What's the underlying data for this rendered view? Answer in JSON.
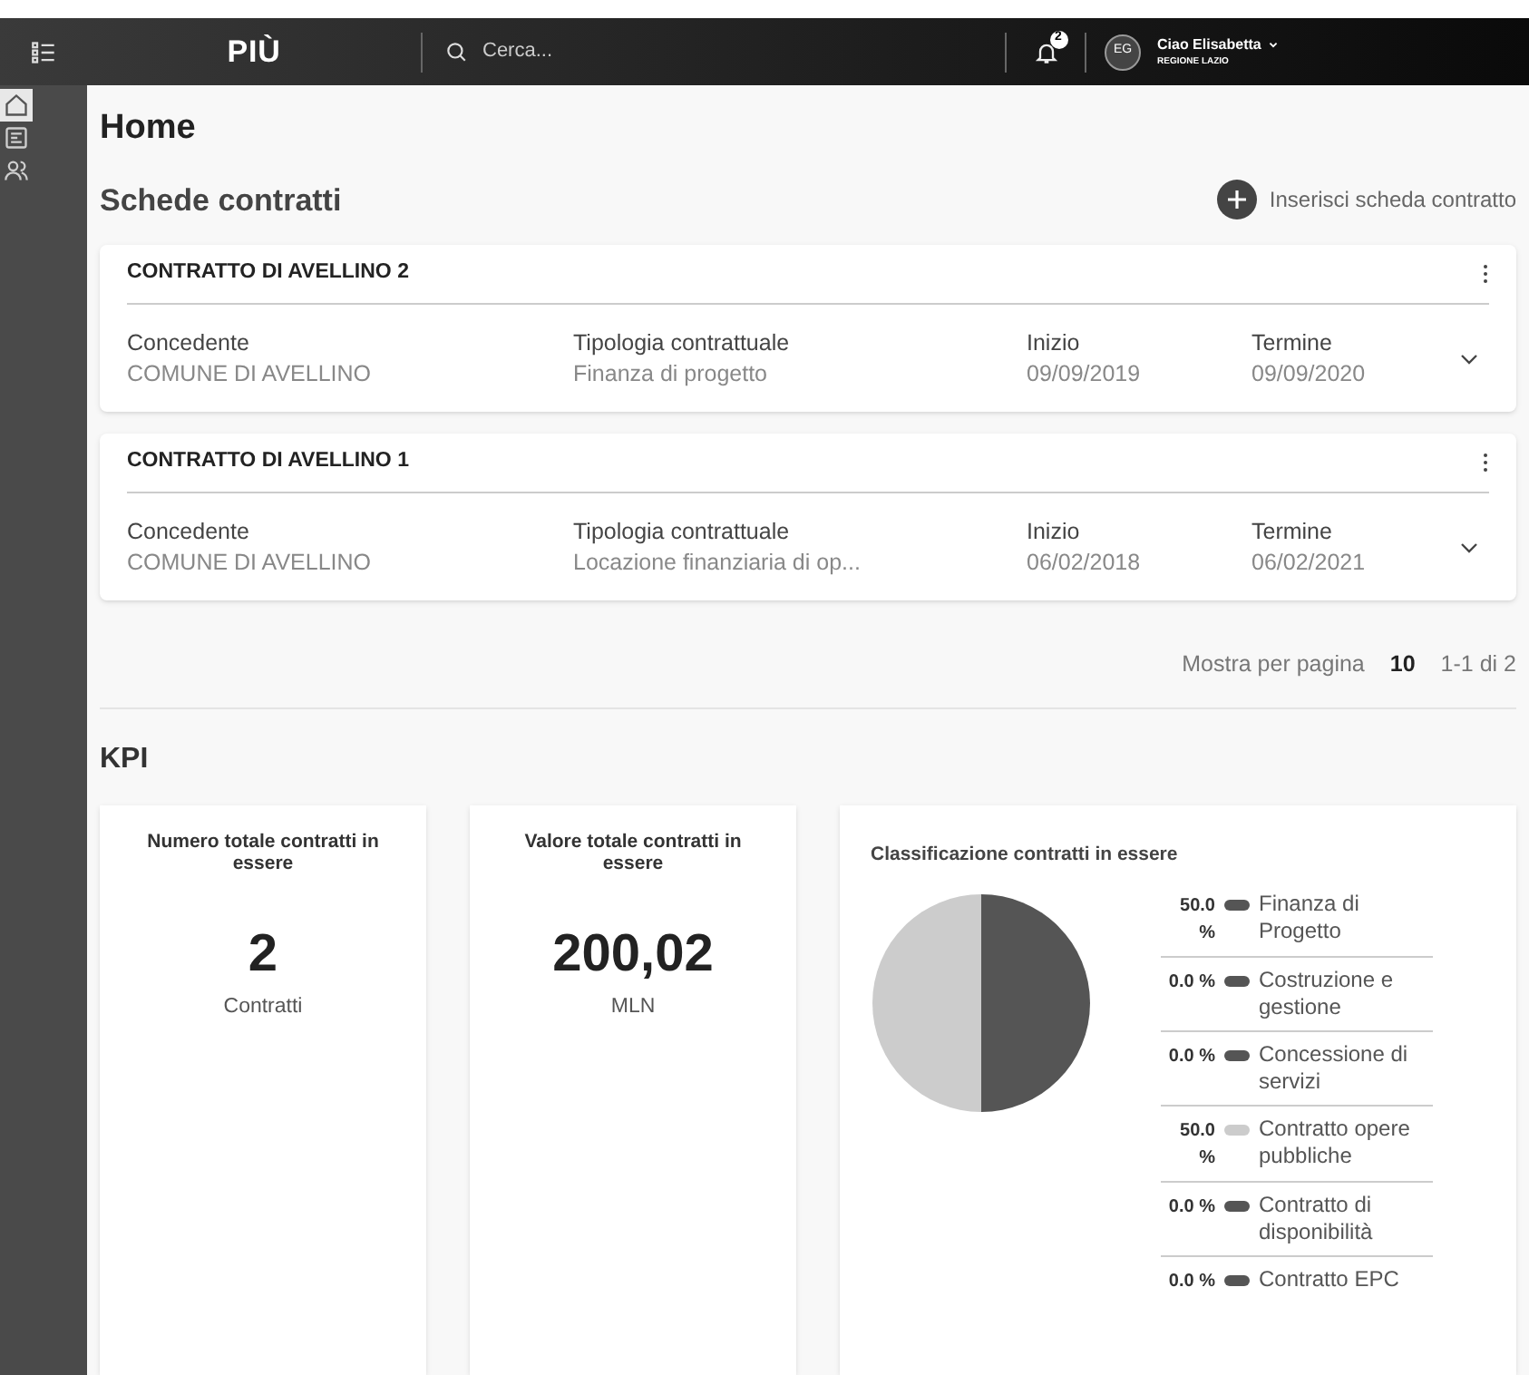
{
  "topbar": {
    "logo": "PIÙ",
    "search": {
      "placeholder": "Cerca..."
    },
    "notifications": "2",
    "avatar": "EG",
    "greeting": "Ciao Elisabetta",
    "region": "REGIONE LAZIO"
  },
  "sidebar": {
    "items": [
      {
        "kind": "home",
        "selected": true
      },
      {
        "kind": "document",
        "selected": false
      },
      {
        "kind": "users",
        "selected": false
      }
    ]
  },
  "page_title": "Home",
  "contracts": {
    "title": "Schede contratti",
    "add_button": "Inserisci scheda contratto",
    "cards": [
      {
        "title": "CONTRATTO DI AVELLINO 2",
        "fields": [
          {
            "label": "Concedente",
            "value": "COMUNE DI AVELLINO"
          },
          {
            "label": "Tipologia contrattuale",
            "value": "Finanza di progetto"
          },
          {
            "label": "Inizio",
            "value": "09/09/2019"
          },
          {
            "label": "Termine",
            "value": "09/09/2020"
          }
        ]
      },
      {
        "title": "CONTRATTO DI AVELLINO 1",
        "fields": [
          {
            "label": "Concedente",
            "value": "COMUNE DI AVELLINO"
          },
          {
            "label": "Tipologia contrattuale",
            "value": "Locazione finanziaria di op..."
          },
          {
            "label": "Inizio",
            "value": "06/02/2018"
          },
          {
            "label": "Termine",
            "value": "06/02/2021"
          }
        ]
      }
    ],
    "pagination": {
      "label": "Mostra per pagina",
      "page_size": "10",
      "range": "1-1 di 2"
    }
  },
  "kpi": {
    "title": "KPI",
    "cards": [
      {
        "title": "Numero totale contratti in essere",
        "value": "2",
        "unit": "Contratti"
      },
      {
        "title": "Valore totale contratti in essere",
        "value": "200,02",
        "unit": "MLN"
      }
    ],
    "classification": {
      "title": "Classificazione contratti in essere",
      "legend": [
        {
          "value": "50.0 %",
          "color": "#555555"
        },
        {
          "value": "0.0 %",
          "color": "#555555"
        },
        {
          "value": "0.0 %",
          "color": "#555555"
        },
        {
          "value": "50.0 %",
          "color": "#cccccc"
        },
        {
          "value": "0.0 %",
          "color": "#555555"
        },
        {
          "value": "0.0 %",
          "color": "#555555"
        }
      ],
      "chart_data": {
        "type": "pie",
        "categories": [
          "Finanza di Progetto",
          "Costruzione e gestione",
          "Concessione di servizi",
          "Contratto opere pubbliche",
          "Contratto di disponibilità",
          "Contratto EPC"
        ],
        "values": [
          50,
          0,
          0,
          50,
          0,
          0
        ]
      }
    }
  }
}
